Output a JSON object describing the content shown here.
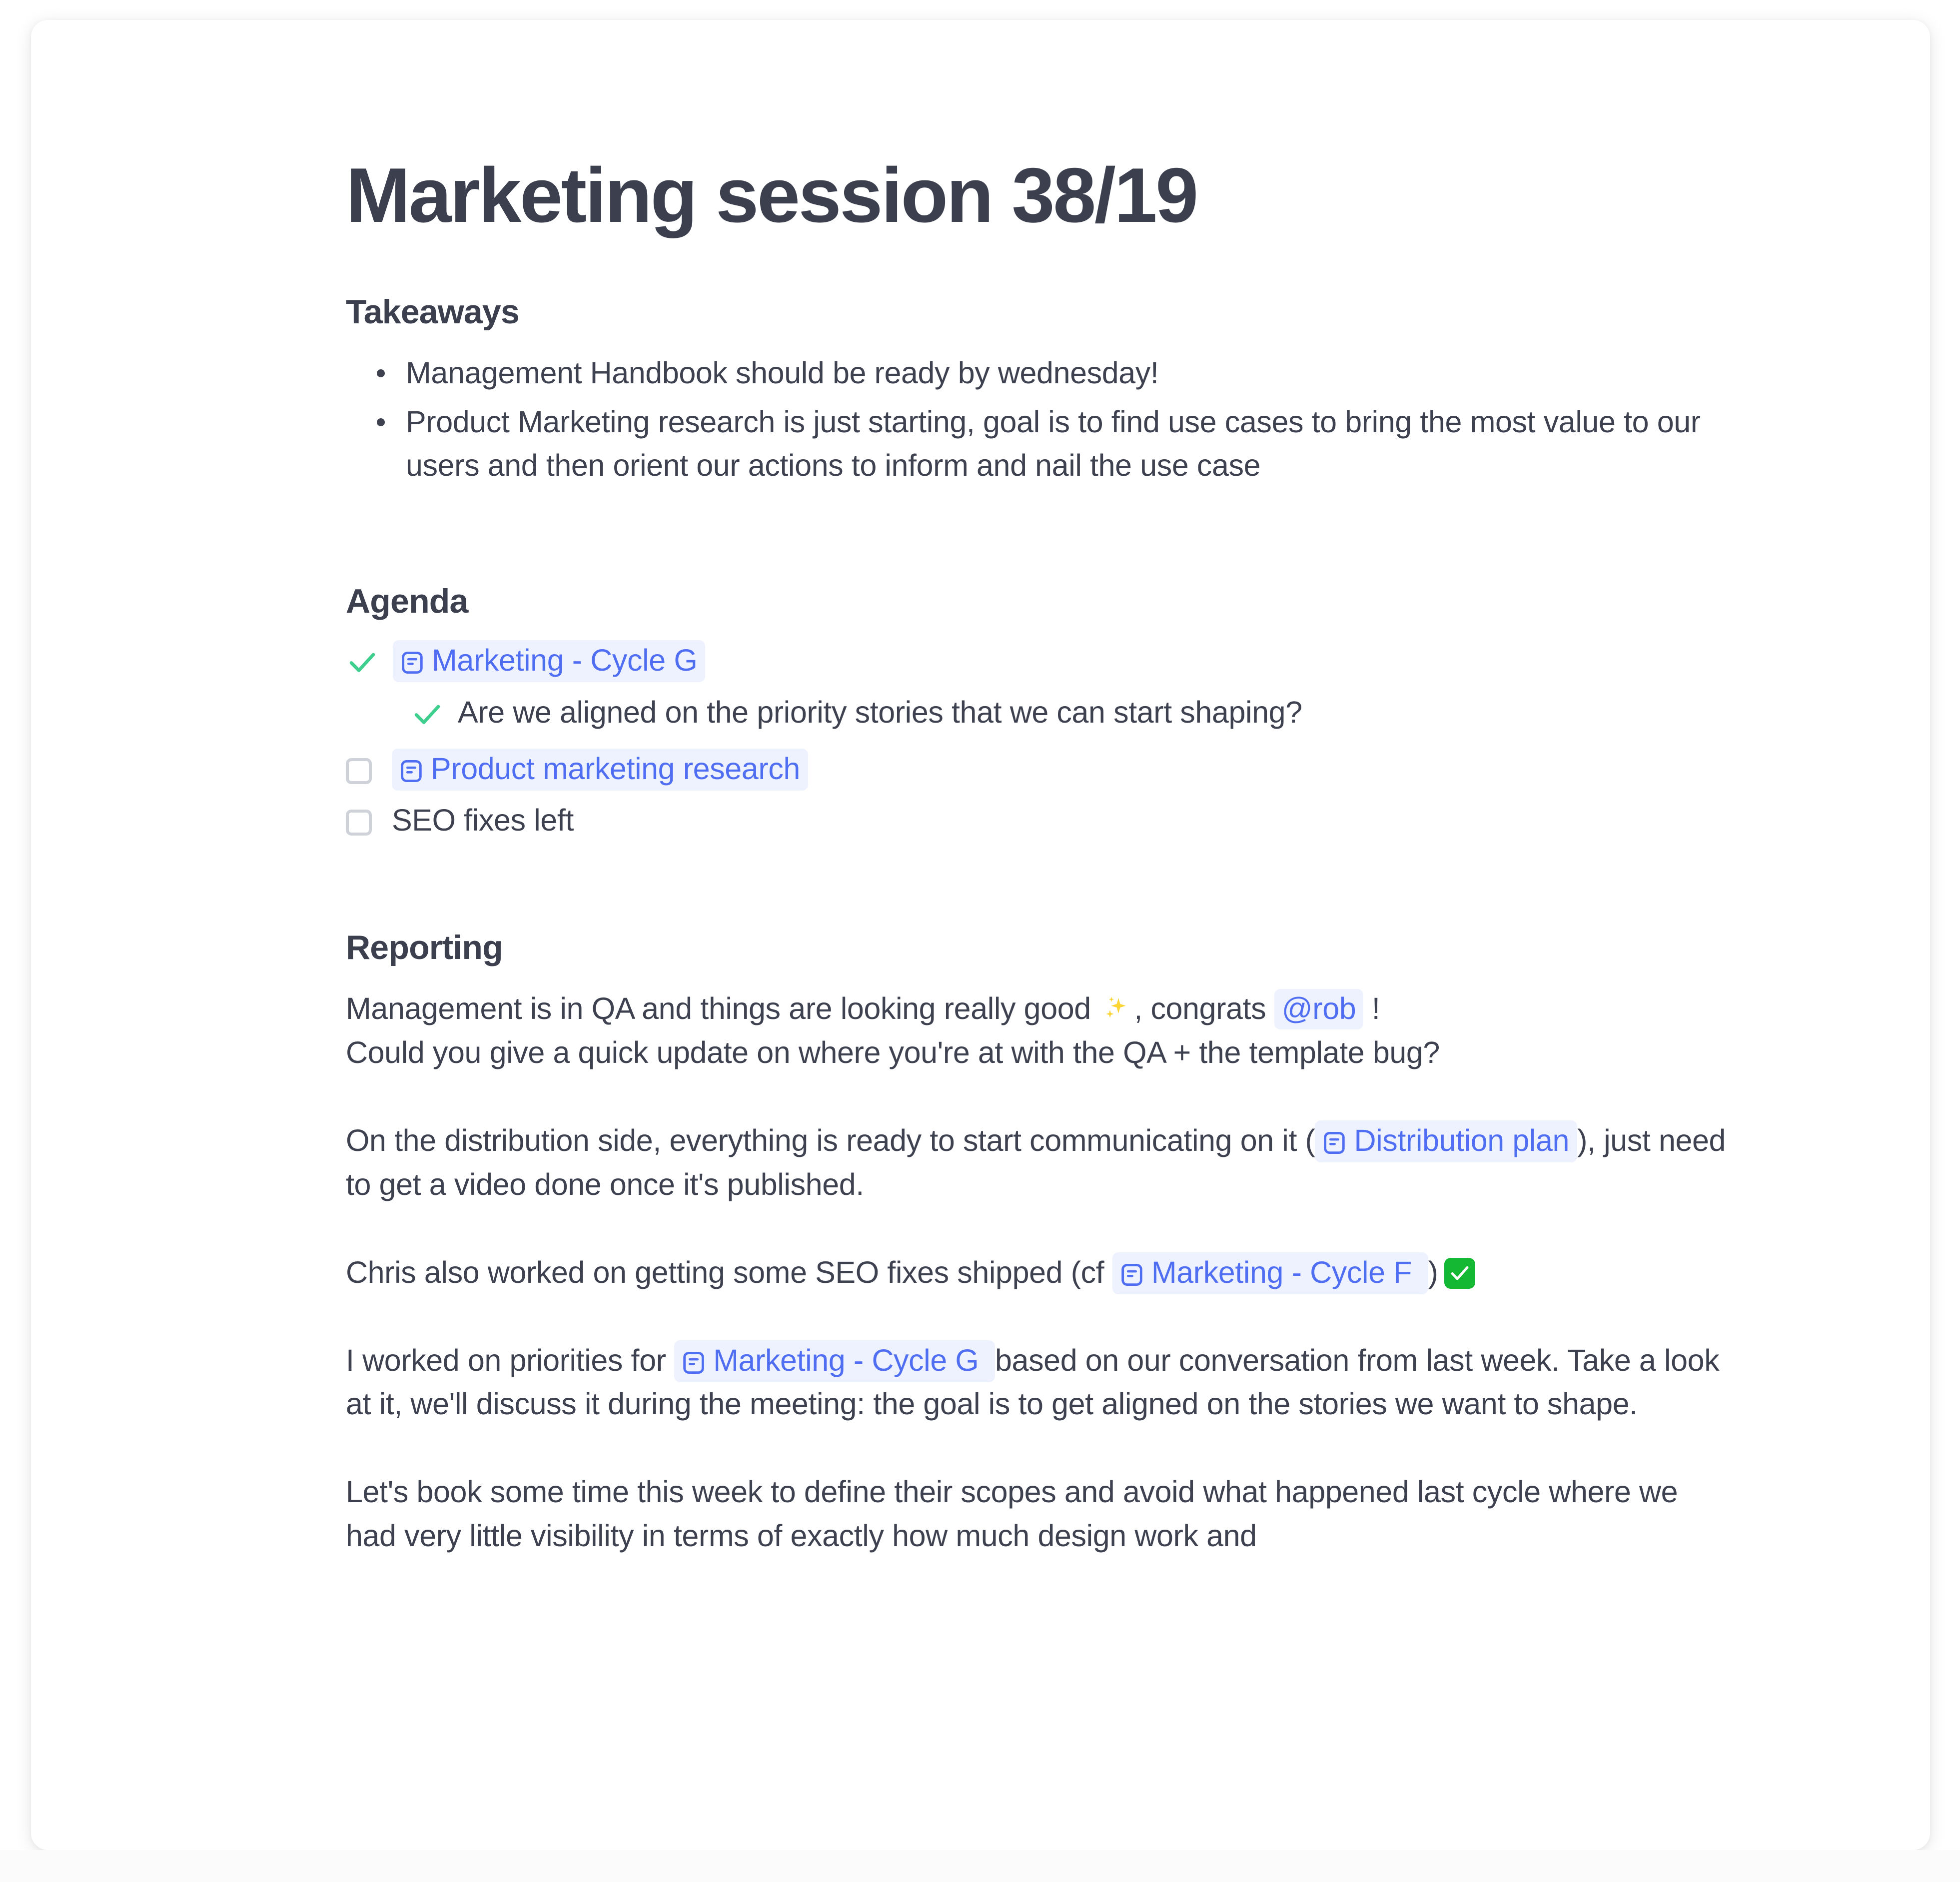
{
  "document": {
    "title": "Marketing session 38/19",
    "sections": {
      "takeaways": {
        "heading": "Takeaways",
        "bullets": [
          "Management Handbook should be ready by wednesday!",
          "Product Marketing research is just starting, goal is to find use cases to bring the most value to our users and then orient our actions to inform and nail the use case"
        ]
      },
      "agenda": {
        "heading": "Agenda",
        "items": [
          {
            "checked": true,
            "is_link": true,
            "label": "Marketing - Cycle G",
            "icon": "page-icon"
          },
          {
            "checked": true,
            "is_link": false,
            "label": "Are we aligned on the priority stories that we can start shaping?",
            "indent": true
          },
          {
            "checked": false,
            "is_link": true,
            "label": "Product marketing research",
            "icon": "page-icon"
          },
          {
            "checked": false,
            "is_link": false,
            "label": "SEO fixes left"
          }
        ]
      },
      "reporting": {
        "heading": "Reporting",
        "paragraphs": {
          "p1_a": "Management is in QA and things are looking really good",
          "p1_emoji": "sparkles-emoji",
          "p1_b": ", congrats",
          "p1_mention": "@rob",
          "p1_c": "!",
          "p1_line2": "Could you give a quick update on where you're at with the QA + the template bug?",
          "p2_a": "On the distribution side, everything is ready to start communicating on it (",
          "p2_link": "Distribution plan",
          "p2_b": "), just need to get a video done once it's published.",
          "p3_a": "Chris also worked on getting some SEO fixes shipped (cf",
          "p3_link": "Marketing - Cycle F",
          "p3_b": ")",
          "p3_emoji": "white-check-mark-emoji",
          "p4_a": "I worked on priorities for",
          "p4_link": "Marketing - Cycle G",
          "p4_b": "based on our conversation from last week. Take a look at it, we'll discuss it during the meeting: the goal is to get aligned on the stories we want to shape.",
          "p5": "Let's book some time this week to define their scopes and avoid what happened last cycle where we had very little visibility in terms of exactly how much design work and"
        }
      }
    },
    "colors": {
      "link": "#4f6ef2",
      "link_bg": "#eef1fe",
      "heading": "#3b3f4e",
      "body": "#3e4250",
      "check_green": "#3ecf8e",
      "emoji_green": "#14b832",
      "checkbox_border": "#cfd2d8"
    }
  }
}
